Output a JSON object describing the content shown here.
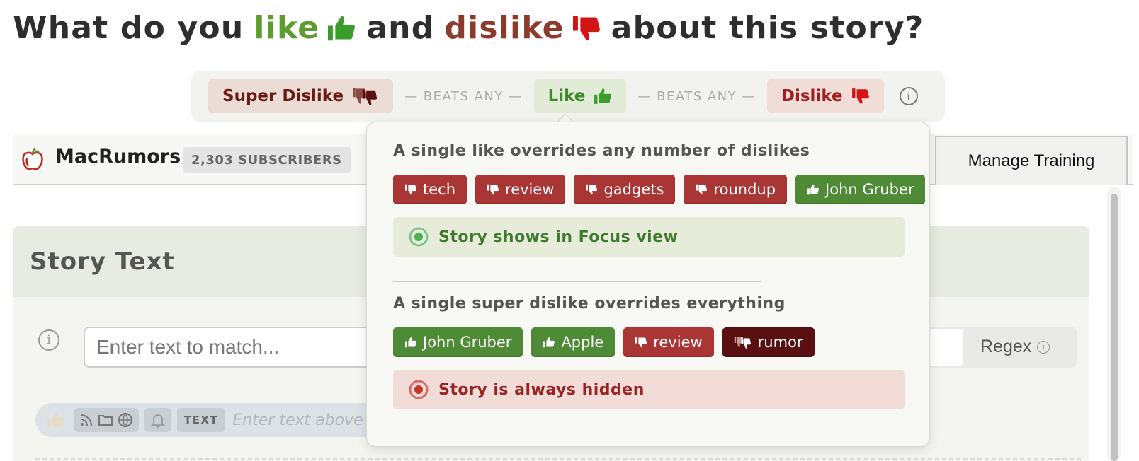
{
  "heading": {
    "part1": "What do you",
    "like_word": "like",
    "part2": "and",
    "dislike_word": "dislike",
    "part3": "about this story?"
  },
  "hierarchy": {
    "super_dislike_label": "Super Dislike",
    "beats_any_1": "— BEATS ANY —",
    "like_label": "Like",
    "beats_any_2": "— BEATS ANY —",
    "dislike_label": "Dislike",
    "info_glyph": "i"
  },
  "feed": {
    "title": "MacRumors",
    "subscribers": "2,303 SUBSCRIBERS",
    "manage_training": "Manage Training"
  },
  "story_panel": {
    "title": "Story Text",
    "input_placeholder": "Enter text to match...",
    "regex_label": "Regex",
    "rule_tag": "TEXT",
    "rule_placeholder": "Enter text above"
  },
  "popover": {
    "section1_title": "A single like overrides any number of dislikes",
    "section1_chips": [
      {
        "label": "tech",
        "kind": "dislike"
      },
      {
        "label": "review",
        "kind": "dislike"
      },
      {
        "label": "gadgets",
        "kind": "dislike"
      },
      {
        "label": "roundup",
        "kind": "dislike"
      },
      {
        "label": "John Gruber",
        "kind": "like"
      }
    ],
    "section1_result": "Story shows in Focus view",
    "section2_title": "A single super dislike overrides everything",
    "section2_chips": [
      {
        "label": "John Gruber",
        "kind": "like"
      },
      {
        "label": "Apple",
        "kind": "like"
      },
      {
        "label": "review",
        "kind": "dislike"
      },
      {
        "label": "rumor",
        "kind": "super-dislike"
      }
    ],
    "section2_result": "Story is always hidden"
  },
  "colors": {
    "like_green": "#5d9d2f",
    "dislike_red": "#a93535",
    "super_dislike": "#5a1010",
    "focus_bg": "#e6ecd9",
    "hidden_bg": "#f1dcd8"
  },
  "icons": {
    "like": "thumbs-up-icon",
    "dislike": "thumbs-down-icon",
    "super_dislike": "double-thumbs-down-icon",
    "focus": "focus-target-icon",
    "hidden": "hidden-target-icon",
    "info": "info-icon",
    "feed": "apple-logo-icon"
  }
}
